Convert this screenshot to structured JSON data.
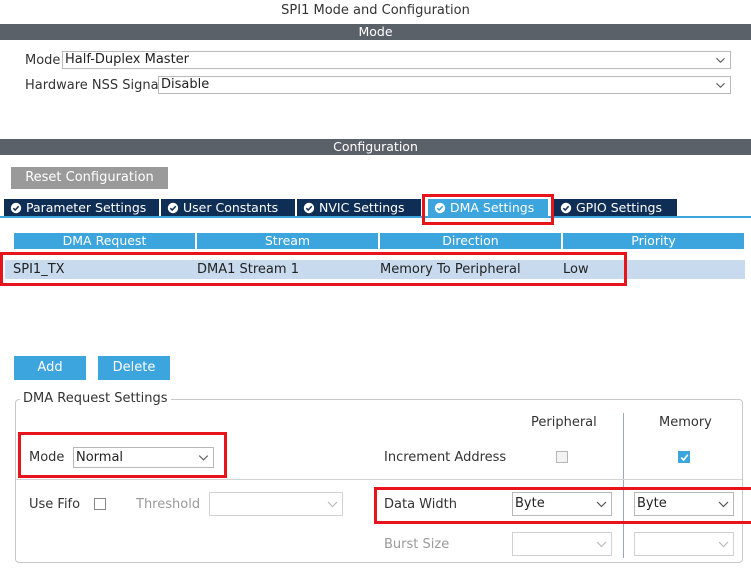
{
  "window": {
    "title": "SPI1 Mode and Configuration"
  },
  "mode_section": {
    "header": "Mode",
    "mode_label": "Mode",
    "mode_value": "Half-Duplex Master",
    "nss_label": "Hardware NSS Signal",
    "nss_value": "Disable"
  },
  "config_section": {
    "header": "Configuration",
    "reset_button": "Reset Configuration",
    "tabs": [
      {
        "label": "Parameter Settings",
        "active": false
      },
      {
        "label": "User Constants",
        "active": false
      },
      {
        "label": "NVIC Settings",
        "active": false
      },
      {
        "label": "DMA Settings",
        "active": true
      },
      {
        "label": "GPIO Settings",
        "active": false
      }
    ]
  },
  "dma_table": {
    "columns": [
      "DMA Request",
      "Stream",
      "Direction",
      "Priority"
    ],
    "rows": [
      [
        "SPI1_TX",
        "DMA1 Stream 1",
        "Memory To Peripheral",
        "Low"
      ]
    ]
  },
  "actions": {
    "add": "Add",
    "delete": "Delete"
  },
  "request_settings": {
    "legend": "DMA Request Settings",
    "col_peripheral": "Peripheral",
    "col_memory": "Memory",
    "mode_label": "Mode",
    "mode_value": "Normal",
    "increment_label": "Increment Address",
    "increment_peripheral": false,
    "increment_memory": true,
    "use_fifo_label": "Use Fifo",
    "use_fifo": false,
    "threshold_label": "Threshold",
    "threshold_value": "",
    "data_width_label": "Data Width",
    "data_width_peripheral": "Byte",
    "data_width_memory": "Byte",
    "burst_label": "Burst Size",
    "burst_peripheral": "",
    "burst_memory": ""
  },
  "colors": {
    "accent": "#3da5dd",
    "tab_dark": "#0f2e56",
    "header_bar": "#5b6168",
    "row_selected": "#c8daee",
    "highlight": "#e8141b"
  }
}
